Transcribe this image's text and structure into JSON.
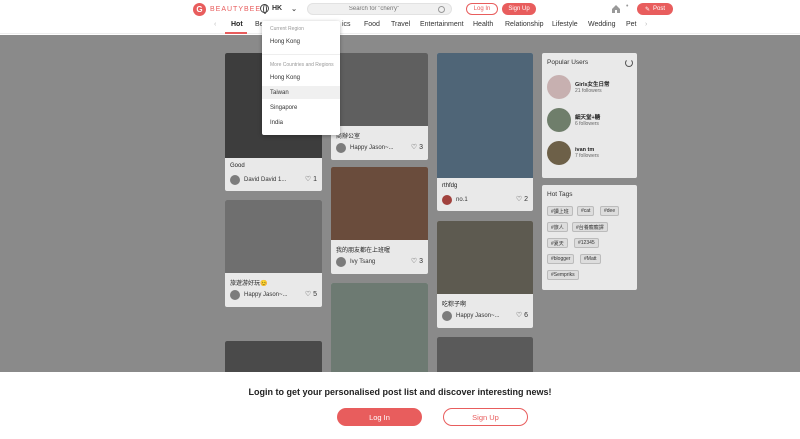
{
  "header": {
    "logo_text": "BEAUTYBEE",
    "region_code": "HK",
    "search_placeholder": "Search for \"cherry\"",
    "login_label": "Log In",
    "signup_label": "Sign Up",
    "post_label": "Post"
  },
  "categories": [
    "Hot",
    "Be",
    "ics",
    "Food",
    "Travel",
    "Entertainment",
    "Health",
    "Relationship",
    "Lifestyle",
    "Wedding",
    "Pet"
  ],
  "region_dropdown": {
    "current_heading": "Current Region",
    "current": "Hong Kong",
    "more_heading": "More Countries and Regions",
    "options": [
      "Hong Kong",
      "Taiwan",
      "Singapore",
      "India"
    ],
    "hovered": "Taiwan"
  },
  "posts": [
    {
      "title": "Good",
      "author": "David David 1...",
      "likes": "1"
    },
    {
      "title": "旅遊游好玩😊",
      "author": "Happy Jason~...",
      "likes": "5"
    },
    {
      "title": "商辦公室",
      "author": "Happy Jason~...",
      "likes": "3"
    },
    {
      "title": "我的朋友都在上班喔",
      "author": "Ivy Tsang",
      "likes": "3"
    },
    {
      "title": "rthfdg",
      "author": "no.1",
      "likes": "2"
    },
    {
      "title": "吃粽子啊",
      "author": "Happy Jason~...",
      "likes": "6"
    }
  ],
  "popular_users": {
    "title": "Popular Users",
    "users": [
      {
        "name": "Girls女生日常",
        "followers": "21 followers"
      },
      {
        "name": "細天堂+糖",
        "followers": "6 followers"
      },
      {
        "name": "ivan tm",
        "followers": "7 followers"
      }
    ]
  },
  "hot_tags": {
    "title": "Hot Tags",
    "tags": [
      "#讀上班",
      "#cat",
      "#dee",
      "#旅人",
      "#台養寵寵譯",
      "#夏天",
      "#12345",
      "#blogger",
      "#Matt",
      "#Sempriks"
    ]
  },
  "login_prompt": {
    "message": "Login to get your personalised post list and discover interesting news!",
    "login_label": "Log In",
    "signup_label": "Sign Up"
  },
  "colors": {
    "accent": "#e85d5d"
  }
}
